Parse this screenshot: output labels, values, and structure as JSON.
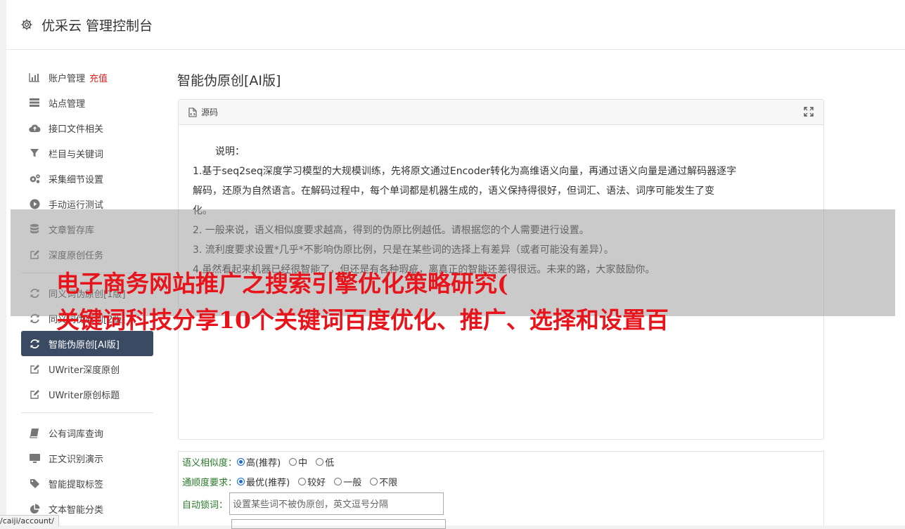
{
  "header": {
    "title": "优采云 管理控制台",
    "icon": "gear-icon"
  },
  "sidebar": {
    "items": [
      {
        "label": "账户管理",
        "extra": "充值",
        "icon": "bar-chart-icon"
      },
      {
        "label": "站点管理",
        "icon": "server-icon"
      },
      {
        "label": "接口文件相关",
        "icon": "cloud-upload-icon"
      },
      {
        "label": "栏目与关键词",
        "icon": "filter-icon"
      },
      {
        "label": "采集细节设置",
        "icon": "cogs-icon"
      },
      {
        "label": "手动运行测试",
        "icon": "play-circle-icon"
      },
      {
        "label": "文章暂存库",
        "icon": "database-icon"
      },
      {
        "label": "深度原创任务",
        "icon": "edit-icon"
      },
      {
        "label": "同义词伪原创[1版]",
        "icon": "refresh-icon"
      },
      {
        "label": "同义词伪原创[2版]",
        "icon": "refresh-icon"
      },
      {
        "label": "智能伪原创[AI版]",
        "icon": "refresh-icon"
      },
      {
        "label": "UWriter深度原创",
        "icon": "edit-icon"
      },
      {
        "label": "UWriter原创标题",
        "icon": "edit-icon"
      },
      {
        "label": "公有词库查询",
        "icon": "book-icon"
      },
      {
        "label": "正文识别演示",
        "icon": "monitor-icon"
      },
      {
        "label": "智能提取标签",
        "icon": "tag-icon"
      },
      {
        "label": "文本智能分类",
        "icon": "pie-chart-icon"
      }
    ]
  },
  "page": {
    "title": "智能伪原创[AI版]"
  },
  "panel": {
    "header": "源码",
    "lines": [
      "说明：",
      "1.基于seq2seq深度学习模型的大规模训练，先将原文通过Encoder转化为高维语义向量，再通过语义向量是通过解码器逐字",
      "解码，还原为自然语言。在解码过程中，每个单词都是机器生成的，语义保持得很好，但词汇、语法、词序可能发生了变",
      "化。",
      "2. 一般来说，语义相似度要求越高，得到的伪原比例越低。请根据您的个人需要进行设置。",
      "3. 流利度要求设置*几乎*不影响伪原比例，只是在某些词的选择上有差异（或者可能没有差异）。",
      "4.虽然看起来机器已经很智能了，但还是有各种瑕疵，离真正的智能还差得很远。未来的路，大家鼓励你。"
    ]
  },
  "overlay": {
    "line1": "电子商务网站推广之搜索引擎优化策略研究(",
    "line2": "关键词科技分享10个关键词百度优化、推广、选择和设置百"
  },
  "options": {
    "similarity": {
      "label": "语义相似度：",
      "options": [
        "高(推荐)",
        "中",
        "低"
      ],
      "selected": "高(推荐)"
    },
    "fluency": {
      "label": "通顺度要求：",
      "options": [
        "最优(推荐)",
        "较好",
        "一般",
        "不限"
      ],
      "selected": "最优(推荐)"
    },
    "lock": {
      "label": "自动锁词：",
      "placeholder": "设置某些词不被伪原创，英文逗号分隔",
      "value": ""
    }
  },
  "statusbar": {
    "url": "/caiji/account/"
  }
}
